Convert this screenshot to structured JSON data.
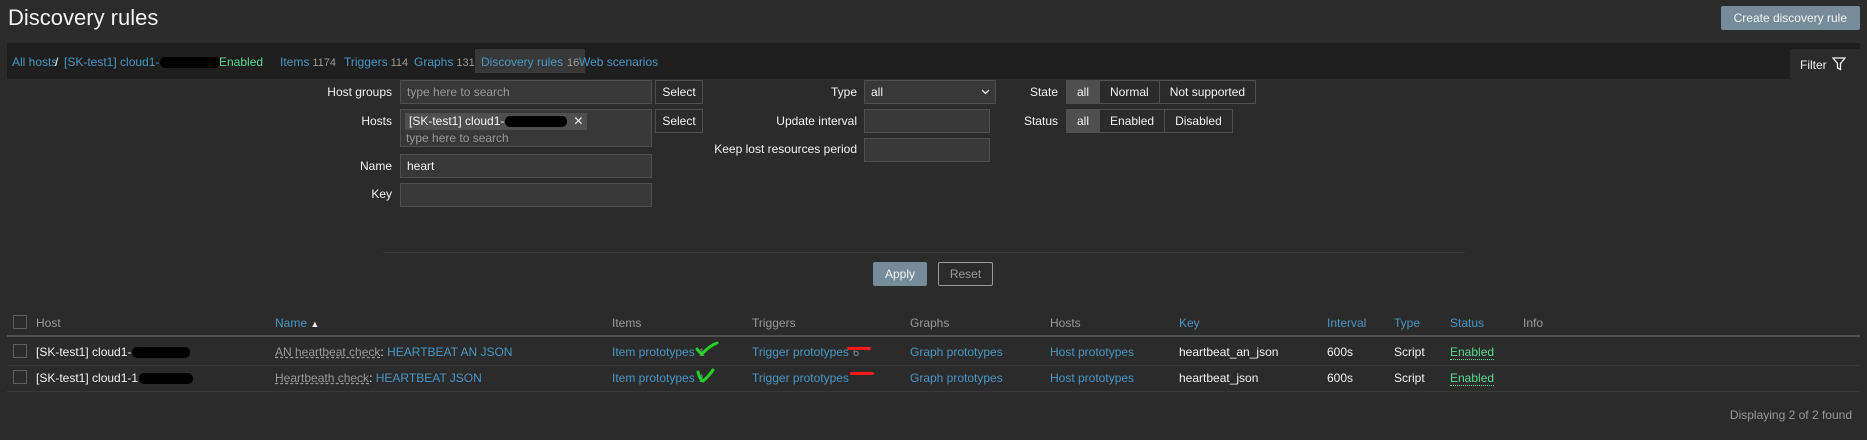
{
  "page": {
    "title": "Discovery rules",
    "create_button": "Create discovery rule"
  },
  "nav": {
    "all_hosts": "All hosts",
    "sep": "/",
    "host": "[SK-test1] cloud1-",
    "status": "Enabled",
    "items": {
      "label": "Items",
      "count": "1174"
    },
    "triggers": {
      "label": "Triggers",
      "count": "114"
    },
    "graphs": {
      "label": "Graphs",
      "count": "131"
    },
    "discovery": {
      "label": "Discovery rules",
      "count": "16"
    },
    "web": {
      "label": "Web scenarios"
    }
  },
  "filter": {
    "tab_label": "Filter",
    "host_groups": {
      "label": "Host groups",
      "placeholder": "type here to search",
      "select": "Select"
    },
    "hosts": {
      "label": "Hosts",
      "tag": "[SK-test1] cloud1-",
      "placeholder": "type here to search",
      "select": "Select"
    },
    "name": {
      "label": "Name",
      "value": "heart"
    },
    "key": {
      "label": "Key",
      "value": ""
    },
    "type": {
      "label": "Type",
      "value": "all"
    },
    "update_interval": {
      "label": "Update interval",
      "value": ""
    },
    "keep_lost": {
      "label": "Keep lost resources period",
      "value": ""
    },
    "state": {
      "label": "State",
      "options": [
        "all",
        "Normal",
        "Not supported"
      ],
      "selected": "all"
    },
    "status": {
      "label": "Status",
      "options": [
        "all",
        "Enabled",
        "Disabled"
      ],
      "selected": "all"
    },
    "apply": "Apply",
    "reset": "Reset"
  },
  "table": {
    "columns": {
      "host": "Host",
      "name": "Name",
      "items": "Items",
      "triggers": "Triggers",
      "graphs": "Graphs",
      "hosts": "Hosts",
      "key": "Key",
      "interval": "Interval",
      "type": "Type",
      "status": "Status",
      "info": "Info"
    },
    "sort_indicator": "▲",
    "rows": [
      {
        "host": "[SK-test1] cloud1-",
        "template": "AN heartbeat check",
        "name_sep": ":",
        "name": "HEARTBEAT AN JSON",
        "items": "Item prototypes",
        "items_count": "1",
        "triggers": "Trigger prototypes",
        "triggers_count": "6",
        "graphs": "Graph prototypes",
        "hosts": "Host prototypes",
        "key": "heartbeat_an_json",
        "interval": "600s",
        "type": "Script",
        "status": "Enabled"
      },
      {
        "host": "[SK-test1] cloud1-1",
        "template": "Heartbeath check",
        "name_sep": ":",
        "name": "HEARTBEAT JSON",
        "items": "Item prototypes",
        "items_count": "1",
        "triggers": "Trigger prototypes",
        "triggers_count": "",
        "graphs": "Graph prototypes",
        "hosts": "Host prototypes",
        "key": "heartbeat_json",
        "interval": "600s",
        "type": "Script",
        "status": "Enabled"
      }
    ],
    "footer": "Displaying 2 of 2 found"
  },
  "colors": {
    "link": "#4796c4",
    "enabled": "#59db8f",
    "accent_button": "#768d99",
    "annotation_green": "#22d322",
    "annotation_red": "#ff1a1a"
  }
}
